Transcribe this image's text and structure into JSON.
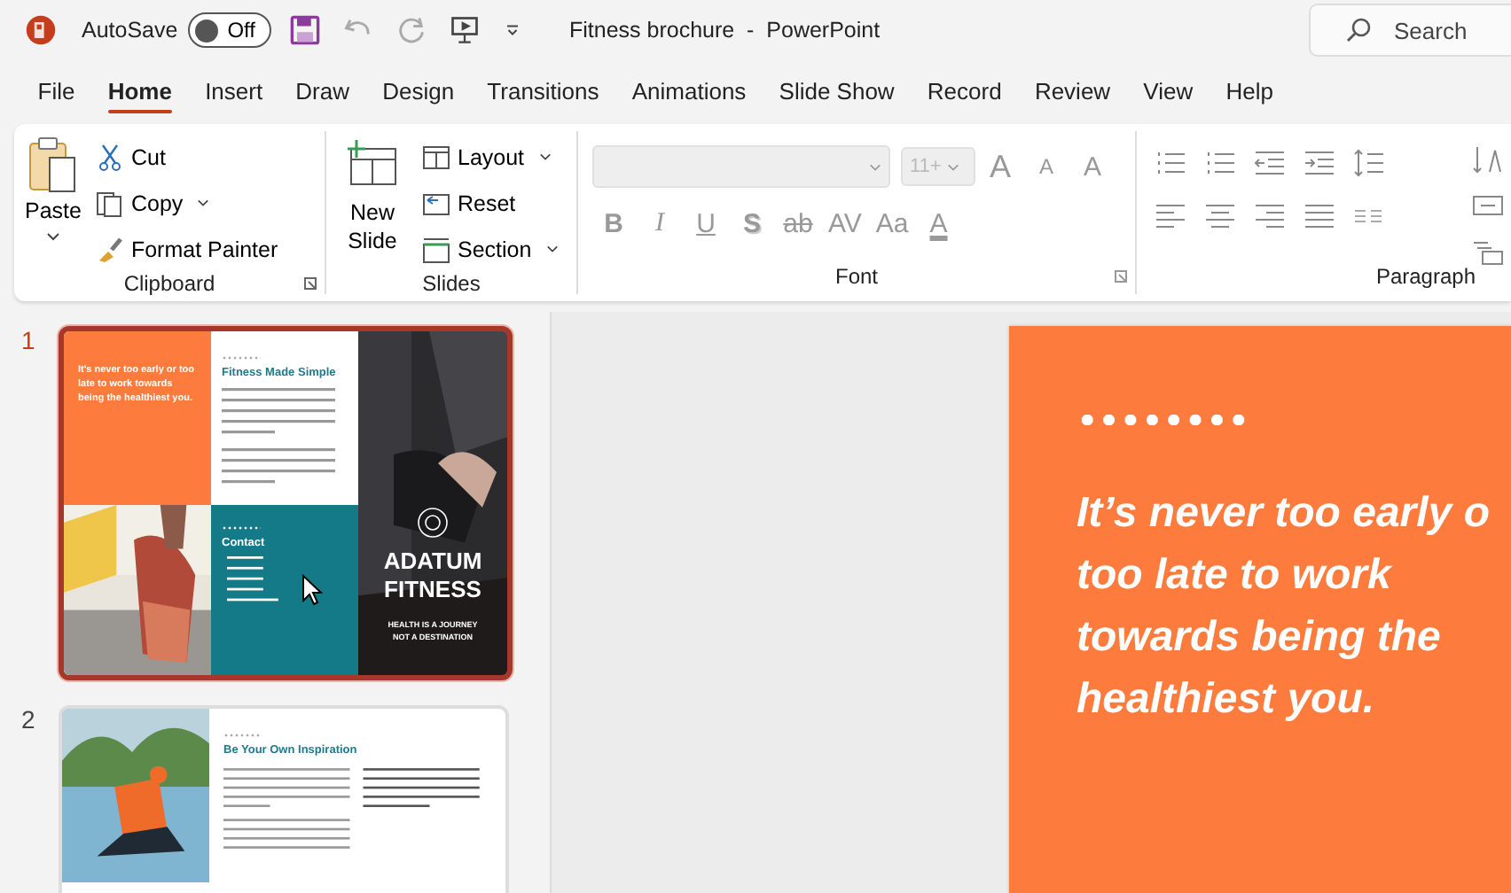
{
  "app": {
    "title": "Fitness brochure  -  PowerPoint",
    "autosave": {
      "label": "AutoSave",
      "on": false,
      "state_text": "Off"
    },
    "search": {
      "placeholder": "Search"
    }
  },
  "menu_tabs": [
    {
      "label": "File",
      "selected": false
    },
    {
      "label": "Home",
      "selected": true
    },
    {
      "label": "Insert",
      "selected": false
    },
    {
      "label": "Draw",
      "selected": false
    },
    {
      "label": "Design",
      "selected": false
    },
    {
      "label": "Transitions",
      "selected": false
    },
    {
      "label": "Animations",
      "selected": false
    },
    {
      "label": "Slide Show",
      "selected": false
    },
    {
      "label": "Record",
      "selected": false
    },
    {
      "label": "Review",
      "selected": false
    },
    {
      "label": "View",
      "selected": false
    },
    {
      "label": "Help",
      "selected": false
    }
  ],
  "clipboard": {
    "label": "Clipboard",
    "paste": "Paste",
    "cut": "Cut",
    "copy": "Copy",
    "format_painter": "Format Painter"
  },
  "slides_group": {
    "label": "Slides",
    "new_slide": "New Slide",
    "layout": "Layout",
    "reset": "Reset",
    "section": "Section"
  },
  "font": {
    "label": "Font",
    "disabled": true,
    "size": "11+",
    "row1": [
      {
        "glyph": "A",
        "kind": "grow"
      },
      {
        "glyph": "A",
        "kind": "shrink"
      },
      {
        "glyph": "A",
        "kind": "clear"
      }
    ],
    "row2": [
      {
        "glyph": "B",
        "kind": "bold"
      },
      {
        "glyph": "I",
        "kind": "italic"
      },
      {
        "glyph": "U",
        "kind": "underline"
      },
      {
        "glyph": "S",
        "kind": "shadow"
      },
      {
        "glyph": "ab",
        "kind": "strike"
      },
      {
        "glyph": "AV",
        "kind": "spacing"
      },
      {
        "glyph": "Aa",
        "kind": "case"
      },
      {
        "glyph": "A",
        "kind": "color"
      }
    ]
  },
  "paragraph": {
    "label": "Paragraph"
  },
  "thumbnails": [
    {
      "number": "1",
      "selected": true,
      "kind": "cover",
      "quote": "It's never too early or too late to work towards being the healthiest you.",
      "heading": "Fitness Made Simple",
      "contact": "Contact",
      "brand": "ADATUM FITNESS",
      "tagline": "HEALTH IS A JOURNEY NOT A DESTINATION"
    },
    {
      "number": "2",
      "selected": false,
      "kind": "inside",
      "heading": "Be Your Own Inspiration"
    }
  ],
  "main_slide": {
    "quote_lines": [
      "It’s never too early o",
      "too late to work",
      "towards being the",
      "healthiest you."
    ]
  }
}
